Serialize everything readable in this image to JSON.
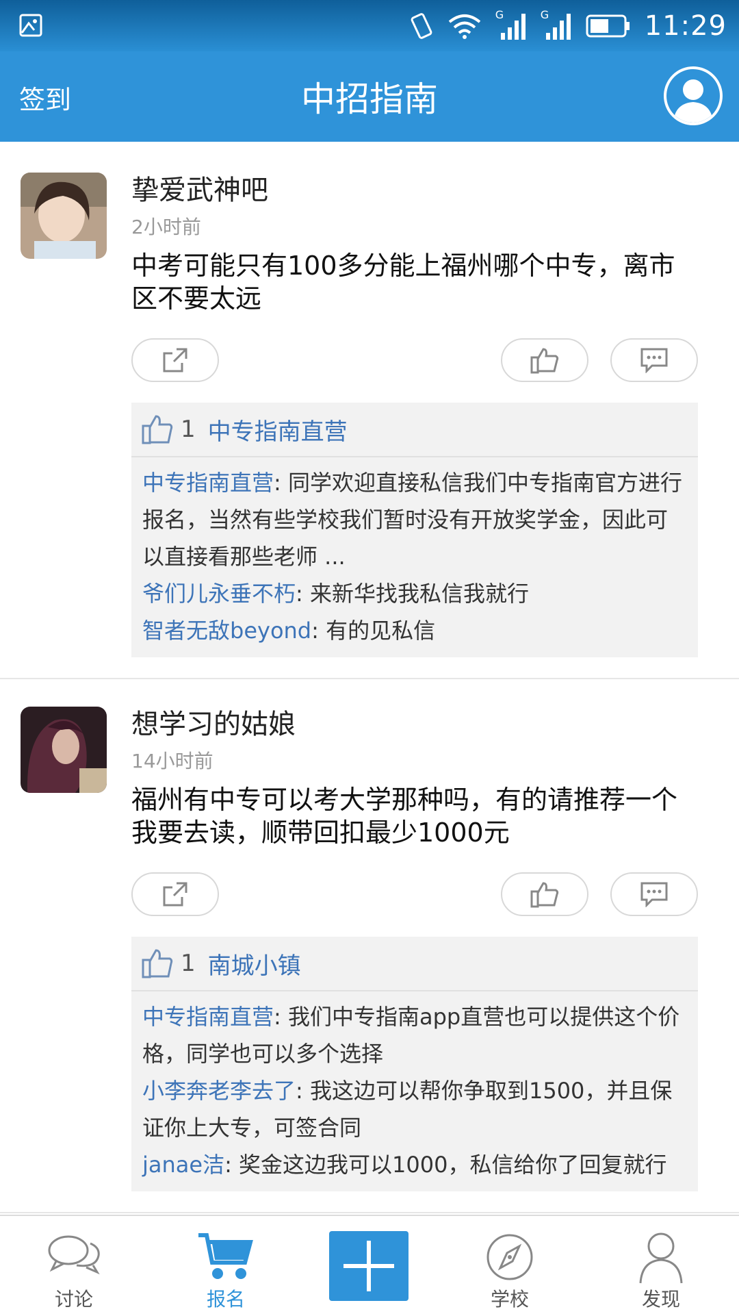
{
  "status_bar": {
    "time": "11:29",
    "network_badge_1": "G",
    "network_badge_2": "G"
  },
  "header": {
    "checkin_label": "签到",
    "title": "中招指南"
  },
  "posts": [
    {
      "user": "挚爱武神吧",
      "time": "2小时前",
      "text": "中考可能只有100多分能上福州哪个中专，离市区不要太远",
      "likes": {
        "count": "1",
        "liker": "中专指南直营"
      },
      "comments": [
        {
          "name": "中专指南直营",
          "text": ": 同学欢迎直接私信我们中专指南官方进行报名，当然有些学校我们暂时没有开放奖学金，因此可以直接看那些老师 ..."
        },
        {
          "name": "爷们儿永垂不朽",
          "text": ": 来新华找我私信我就行"
        },
        {
          "name": "智者无敌beyond",
          "text": ": 有的见私信"
        }
      ]
    },
    {
      "user": "想学习的姑娘",
      "time": "14小时前",
      "text": "福州有中专可以考大学那种吗，有的请推荐一个我要去读，顺带回扣最少1000元",
      "likes": {
        "count": "1",
        "liker": "南城小镇"
      },
      "comments": [
        {
          "name": "中专指南直营",
          "text": ": 我们中专指南app直营也可以提供这个价格，同学也可以多个选择"
        },
        {
          "name": "小李奔老李去了",
          "text": ": 我这边可以帮你争取到1500，并且保证你上大专，可签合同"
        },
        {
          "name": "janae洁",
          "text": ": 奖金这边我可以1000，私信给你了回复就行"
        }
      ]
    }
  ],
  "bottom_nav": {
    "discuss": "讨论",
    "signup": "报名",
    "school": "学校",
    "discover": "发现"
  },
  "colors": {
    "accent": "#2f93d9",
    "link": "#3d74b8"
  }
}
